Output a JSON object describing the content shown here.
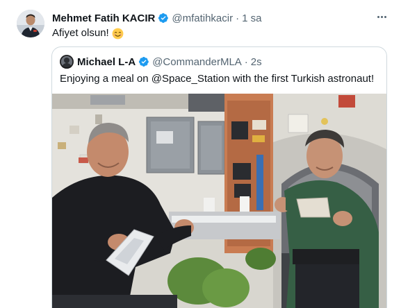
{
  "tweet": {
    "author_name": "Mehmet Fatih KACIR",
    "author_handle": "@mfatihkacir",
    "separator": "·",
    "time": "1 sa",
    "text": "Afiyet olsun!",
    "emoji_icon": "smiling-face-icon",
    "more_icon": "more-dots-icon"
  },
  "quoted": {
    "author_name": "Michael L-A",
    "author_handle": "@CommanderMLA",
    "separator": "·",
    "time": "2s",
    "text": "Enjoying a meal on @Space_Station with the first Turkish astronaut!",
    "media_icon": "space-station-photo"
  },
  "colors": {
    "verified": "#1d9bf0",
    "secondary_text": "#536471",
    "border": "#cfd9de"
  }
}
